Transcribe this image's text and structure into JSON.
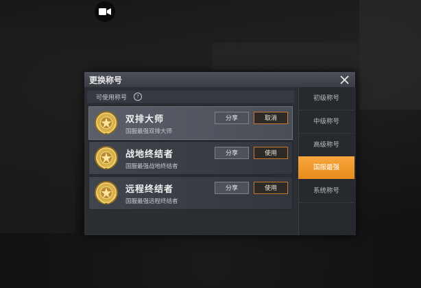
{
  "dialog": {
    "title": "更换称号",
    "available_label": "可使用称号"
  },
  "titles": [
    {
      "name": "双排大师",
      "desc": "国服最强双排大师",
      "share_label": "分享",
      "action_label": "取消",
      "selected": true
    },
    {
      "name": "战地终结者",
      "desc": "国服最强战地终结者",
      "share_label": "分享",
      "action_label": "使用",
      "selected": false
    },
    {
      "name": "远程终结者",
      "desc": "国服最强远程终结者",
      "share_label": "分享",
      "action_label": "使用",
      "selected": false
    }
  ],
  "categories": [
    {
      "label": "初级称号",
      "active": false
    },
    {
      "label": "中级称号",
      "active": false
    },
    {
      "label": "高级称号",
      "active": false
    },
    {
      "label": "国服最强",
      "active": true
    },
    {
      "label": "系统称号",
      "active": false
    }
  ],
  "icons": {
    "record": "video-camera-icon",
    "close": "close-icon",
    "help": "question-icon",
    "badge": "laurel-medal-icon"
  },
  "colors": {
    "accent": "#f0981f",
    "action_border": "#c9782e"
  }
}
